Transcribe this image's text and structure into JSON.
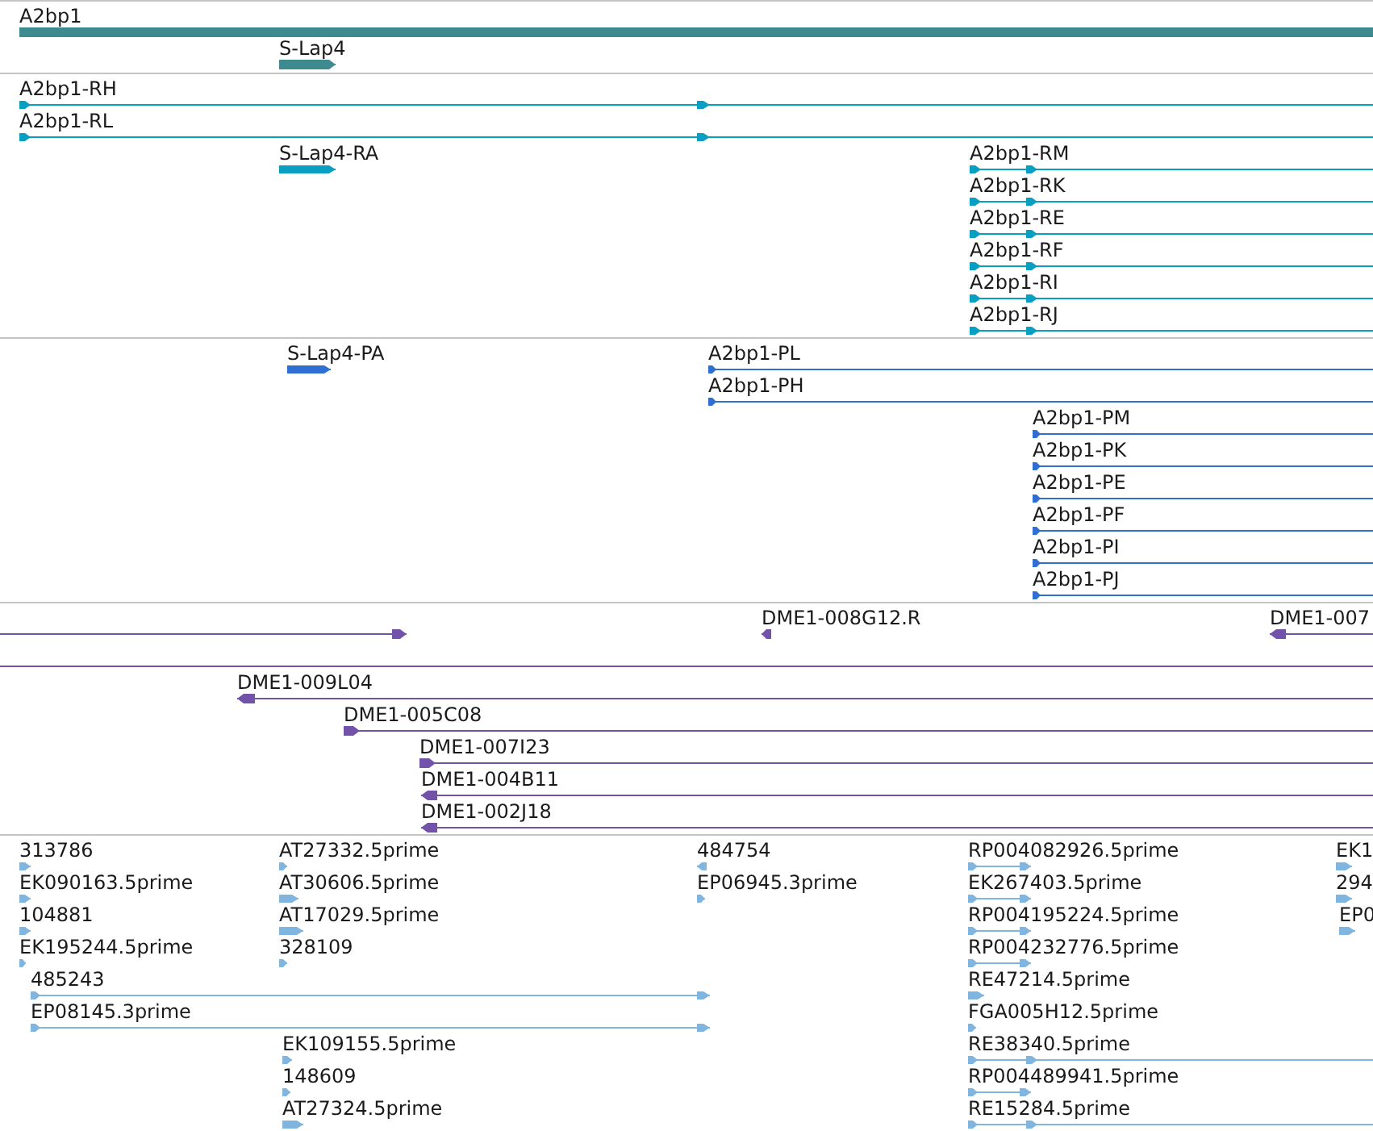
{
  "tracks": [
    {
      "kind": "gene",
      "color": "#3d8b8e",
      "features": [
        {
          "label": "A2bp1",
          "reverse": false
        },
        {
          "label": "S-Lap4",
          "reverse": false
        }
      ]
    },
    {
      "kind": "transcript",
      "color": "#0a9fc2",
      "features": [
        {
          "label": "A2bp1-RH",
          "reverse": false
        },
        {
          "label": "A2bp1-RL",
          "reverse": false
        },
        {
          "label": "S-Lap4-RA",
          "reverse": false
        },
        {
          "label": "A2bp1-RM",
          "reverse": false
        },
        {
          "label": "A2bp1-RK",
          "reverse": false
        },
        {
          "label": "A2bp1-RE",
          "reverse": false
        },
        {
          "label": "A2bp1-RF",
          "reverse": false
        },
        {
          "label": "A2bp1-RI",
          "reverse": false
        },
        {
          "label": "A2bp1-RJ",
          "reverse": false
        }
      ]
    },
    {
      "kind": "protein",
      "color": "#2f6fd2",
      "features": [
        {
          "label": "S-Lap4-PA",
          "reverse": false
        },
        {
          "label": "A2bp1-PL",
          "reverse": false
        },
        {
          "label": "A2bp1-PH",
          "reverse": false
        },
        {
          "label": "A2bp1-PM",
          "reverse": false
        },
        {
          "label": "A2bp1-PK",
          "reverse": false
        },
        {
          "label": "A2bp1-PE",
          "reverse": false
        },
        {
          "label": "A2bp1-PF",
          "reverse": false
        },
        {
          "label": "A2bp1-PI",
          "reverse": false
        },
        {
          "label": "A2bp1-PJ",
          "reverse": false
        }
      ]
    },
    {
      "kind": "clone",
      "color": "#7253a9",
      "features": [
        {
          "reverse": false
        },
        {
          "label": "DME1-008G12.R",
          "reverse": true
        },
        {
          "label": "DME1-007",
          "reverse": true
        },
        {
          "kind": "line"
        },
        {
          "label": "DME1-009L04",
          "reverse": true
        },
        {
          "label": "DME1-005C08",
          "reverse": false
        },
        {
          "label": "DME1-007I23",
          "reverse": false
        },
        {
          "label": "DME1-004B11",
          "reverse": true
        },
        {
          "label": "DME1-002J18",
          "reverse": true
        }
      ]
    },
    {
      "kind": "est",
      "color": "#7fb5de",
      "features": [
        {
          "label": "313786",
          "reverse": false
        },
        {
          "label": "EK090163.5prime",
          "reverse": false
        },
        {
          "label": "104881",
          "reverse": false
        },
        {
          "label": "EK195244.5prime",
          "reverse": false
        },
        {
          "label": "485243",
          "reverse": false
        },
        {
          "label": "EP08145.3prime",
          "reverse": false
        },
        {
          "label": "AT27332.5prime",
          "reverse": false
        },
        {
          "label": "AT30606.5prime",
          "reverse": false
        },
        {
          "label": "AT17029.5prime",
          "reverse": false
        },
        {
          "label": "328109",
          "reverse": false
        },
        {
          "label": "EK109155.5prime",
          "reverse": false
        },
        {
          "label": "148609",
          "reverse": false
        },
        {
          "label": "AT27324.5prime",
          "reverse": false
        },
        {
          "label": "484754",
          "reverse": true
        },
        {
          "label": "EP06945.3prime",
          "reverse": false
        },
        {
          "label": "RP004082926.5prime",
          "reverse": false
        },
        {
          "label": "EK267403.5prime",
          "reverse": false
        },
        {
          "label": "RP004195224.5prime",
          "reverse": false
        },
        {
          "label": "RP004232776.5prime",
          "reverse": false
        },
        {
          "label": "RE47214.5prime",
          "reverse": false
        },
        {
          "label": "FGA005H12.5prime",
          "reverse": false
        },
        {
          "label": "RE38340.5prime",
          "reverse": false
        },
        {
          "label": "RP004489941.5prime",
          "reverse": false
        },
        {
          "label": "RE15284.5prime",
          "reverse": false
        },
        {
          "label": "EK1",
          "reverse": false
        },
        {
          "label": "294",
          "reverse": false
        },
        {
          "label": "EP0",
          "reverse": false
        }
      ]
    }
  ]
}
